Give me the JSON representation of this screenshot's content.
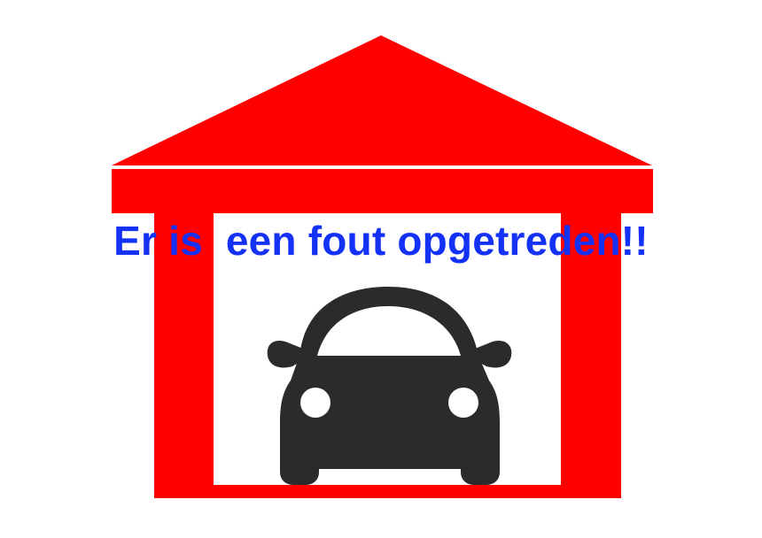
{
  "message": {
    "text": "Er is  een fout opgetreden!!"
  },
  "illustration": {
    "garage_icon": "garage-icon",
    "car_icon": "car-icon"
  },
  "colors": {
    "garage": "#ff0000",
    "car": "#2b2b2b",
    "text": "#1432f5",
    "background": "#ffffff"
  }
}
